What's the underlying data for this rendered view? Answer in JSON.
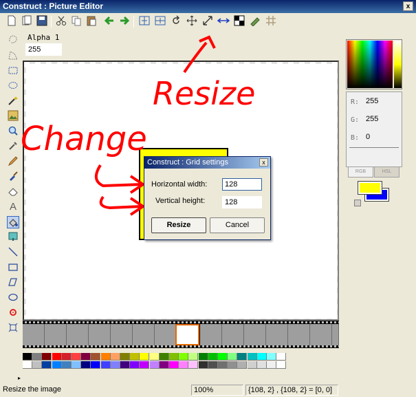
{
  "window": {
    "title": "Construct : Picture Editor",
    "close_glyph": "x"
  },
  "toolbar": {
    "buttons": [
      "new-icon",
      "open-icon",
      "save-icon",
      "cut-icon",
      "copy-icon",
      "paste-icon",
      "undo-icon",
      "redo-icon",
      "flip-horizontal-icon",
      "flip-vertical-icon",
      "rotate-icon",
      "crop-icon",
      "resize-icon",
      "grid-icon",
      "mask-icon",
      "effects-icon",
      "hash-grid-icon"
    ]
  },
  "alpha": {
    "label": "Alpha 1",
    "value": "255"
  },
  "tools": [
    "lasso-icon",
    "polygon-select-icon",
    "rect-select-icon",
    "ellipse-select-icon",
    "magic-wand-icon",
    "image-icon",
    "zoom-icon",
    "eyedropper-icon",
    "pencil-icon",
    "brush-icon",
    "eraser-icon",
    "text-icon",
    "fill-icon",
    "hotspot-icon",
    "line-icon",
    "rectangle-icon",
    "polygon-icon",
    "ellipse-icon",
    "action-point-icon",
    "transform-icon"
  ],
  "dialog": {
    "title": "Construct : Grid settings",
    "close_glyph": "x",
    "horizontal_label": "Horizontal width:",
    "horizontal_value": "128",
    "vertical_label": "Vertical height:",
    "vertical_value": "128",
    "resize_label": "Resize",
    "cancel_label": "Cancel"
  },
  "annotations": {
    "resize": "Resize",
    "change": "Change"
  },
  "color_panel": {
    "r_label": "R:",
    "r_value": "255",
    "g_label": "G:",
    "g_value": "255",
    "b_label": "B:",
    "b_value": "0",
    "tab_rgb": "RGB",
    "tab_hsl": "HSL",
    "foreground": "#ffff00",
    "background": "#0000ff"
  },
  "palette": {
    "row1": [
      "#000000",
      "#808080",
      "#800000",
      "#ff0000",
      "#d4202a",
      "#ff4040",
      "#800040",
      "#a0522d",
      "#ff8000",
      "#ffa060",
      "#808000",
      "#c0c000",
      "#ffff00",
      "#ffff80",
      "#408000",
      "#80c000",
      "#80ff00",
      "#c0ff80",
      "#008000",
      "#00c000",
      "#00ff00",
      "#80ff80",
      "#008080",
      "#00c0c0",
      "#00ffff",
      "#80ffff",
      "#ffffff"
    ],
    "row2": [
      "#ffffff",
      "#c0c0c0",
      "#0040a0",
      "#0080ff",
      "#4080c0",
      "#80c0ff",
      "#000080",
      "#0000ff",
      "#4040ff",
      "#8080ff",
      "#400080",
      "#8000ff",
      "#c000ff",
      "#c080ff",
      "#800080",
      "#ff00ff",
      "#ff80ff",
      "#ffc0ff",
      "#303030",
      "#505050",
      "#707070",
      "#909090",
      "#b0b0b0",
      "#d0d0d0",
      "#e0e0e0",
      "#f0f0f0",
      "#ffffff"
    ]
  },
  "status": {
    "message": "Resize the image",
    "zoom": "100%",
    "coords": "{108, 2} , {108, 2} = [0, 0]"
  }
}
